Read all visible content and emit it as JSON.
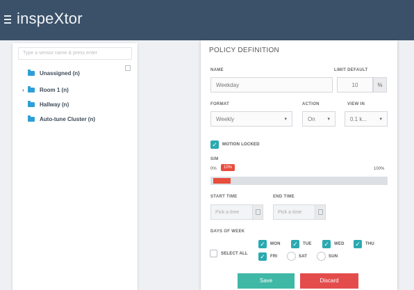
{
  "app": {
    "title": "inspeXtor"
  },
  "tree": {
    "search_placeholder": "Type a sensor name & press enter",
    "items": [
      {
        "label": "Unassigned (n)"
      },
      {
        "label": "Room 1 (n)"
      },
      {
        "label": "Hallway (n)"
      },
      {
        "label": "Auto-tune Cluster (n)"
      }
    ]
  },
  "policy": {
    "title": "POLICY DEFINITION",
    "name_label": "NAME",
    "name_value": "Weekday",
    "limit_label": "LIMIT DEFAULT",
    "limit_value": "10",
    "limit_unit": "%",
    "format_label": "FORMAT",
    "format_value": "Weekly",
    "action_label": "ACTION",
    "action_value": "On",
    "view_label": "VIEW IN",
    "view_value": "0.1 k...",
    "motion_label": "MOTION LOCKED",
    "sim_label": "SIM",
    "sim_start": "0%",
    "sim_badge": "10%",
    "sim_end": "100%",
    "sim_fraction": 0.1,
    "start_time_label": "START TIME",
    "start_time_value": "Pick a time",
    "end_time_label": "END TIME",
    "end_time_value": "Pick a time",
    "days_label": "DAYS OF WEEK",
    "select_all_label": "SELECT ALL",
    "days": [
      {
        "label": "MON",
        "checked": true
      },
      {
        "label": "TUE",
        "checked": true
      },
      {
        "label": "WED",
        "checked": true
      },
      {
        "label": "THU",
        "checked": true
      },
      {
        "label": "FRI",
        "checked": true
      },
      {
        "label": "SAT",
        "checked": false
      },
      {
        "label": "SUN",
        "checked": false
      }
    ],
    "save_label": "Save",
    "discard_label": "Discard"
  },
  "colors": {
    "header": "#3b5169",
    "folder": "#2e9fd6",
    "accent": "#2aaab0",
    "danger": "#e74c3c",
    "save": "#3fb8a6"
  }
}
